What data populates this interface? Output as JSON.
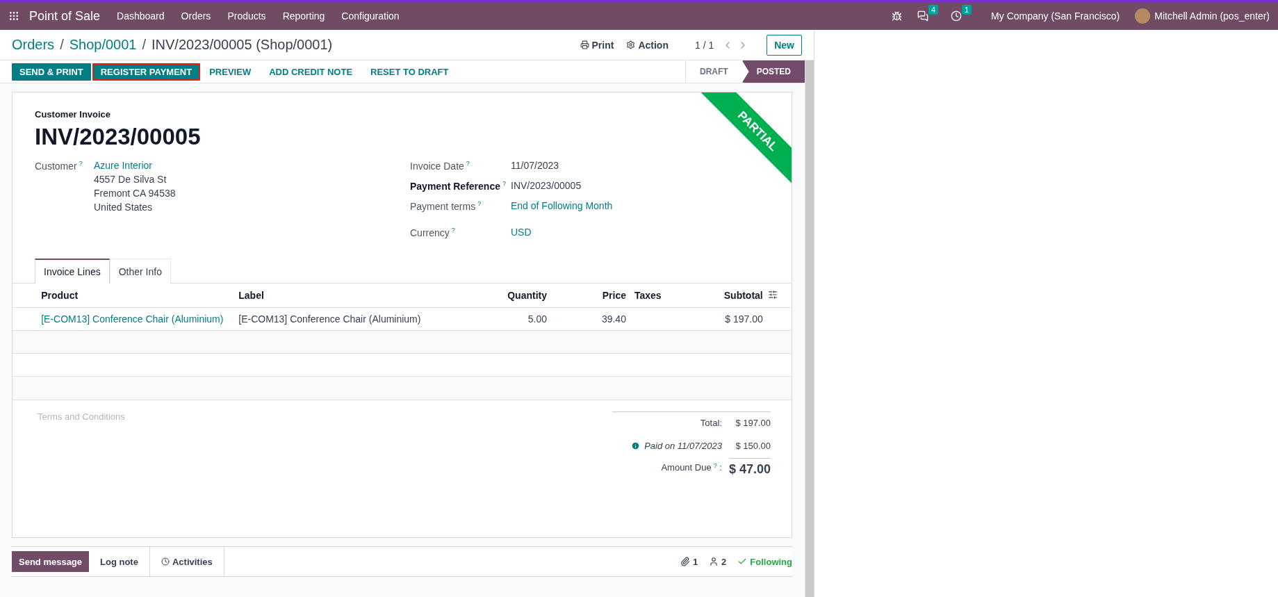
{
  "navbar": {
    "app_name": "Point of Sale",
    "menu": [
      "Dashboard",
      "Orders",
      "Products",
      "Reporting",
      "Configuration"
    ],
    "messages_count": "4",
    "activities_count": "1",
    "company": "My Company (San Francisco)",
    "user": "Mitchell Admin (pos_enter)"
  },
  "breadcrumbs": {
    "separator": "/",
    "items": [
      "Orders",
      "Shop/0001",
      "INV/2023/00005 (Shop/0001)"
    ]
  },
  "control": {
    "print": "Print",
    "action": "Action",
    "pager": "1 / 1",
    "new": "New"
  },
  "action_buttons": [
    {
      "label": "SEND & PRINT",
      "kind": "primary",
      "highlighted": false
    },
    {
      "label": "REGISTER PAYMENT",
      "kind": "primary",
      "highlighted": true
    },
    {
      "label": "PREVIEW",
      "kind": "link",
      "highlighted": false
    },
    {
      "label": "ADD CREDIT NOTE",
      "kind": "link",
      "highlighted": false
    },
    {
      "label": "RESET TO DRAFT",
      "kind": "link",
      "highlighted": false
    }
  ],
  "status_steps": [
    {
      "label": "DRAFT",
      "selected": false
    },
    {
      "label": "POSTED",
      "selected": true
    }
  ],
  "ribbon": "PARTIAL",
  "form": {
    "type_label": "Customer Invoice",
    "number": "INV/2023/00005",
    "customer": {
      "label": "Customer",
      "help": "?",
      "name": "Azure Interior",
      "address": [
        "4557 De Silva St",
        "Fremont CA 94538",
        "United States"
      ]
    },
    "fields": [
      {
        "label": "Invoice Date",
        "help": "?",
        "value": "11/07/2023",
        "kind": "text",
        "required": false
      },
      {
        "label": "Payment Reference",
        "help": "?",
        "value": "INV/2023/00005",
        "kind": "text",
        "required": true
      },
      {
        "label": "Payment terms",
        "help": "?",
        "value": "End of Following Month",
        "kind": "link",
        "required": false
      },
      {
        "label": "Currency",
        "help": "?",
        "value": "USD",
        "kind": "link",
        "required": false
      }
    ]
  },
  "tabs": [
    {
      "label": "Invoice Lines",
      "selected": true
    },
    {
      "label": "Other Info",
      "selected": false
    }
  ],
  "table": {
    "columns": [
      {
        "label": "Product"
      },
      {
        "label": "Label"
      },
      {
        "label": "Quantity"
      },
      {
        "label": "Price"
      },
      {
        "label": "Taxes"
      },
      {
        "label": "Subtotal"
      }
    ],
    "rows": [
      {
        "cells": [
          "[E-COM13] Conference Chair (Aluminium)",
          "[E-COM13] Conference Chair (Aluminium)",
          "5.00",
          "39.40",
          "",
          "$ 197.00"
        ]
      }
    ]
  },
  "terms": {
    "placeholder": "Terms and Conditions"
  },
  "totals": {
    "total_label": "Total:",
    "total": "$ 197.00",
    "payment_label": "Paid on 11/07/2023",
    "payment": "$ 150.00",
    "due_label": "Amount Due",
    "due_help": "?",
    "due_colon": ":",
    "due": "$ 47.00"
  },
  "chatter": {
    "send_message": "Send message",
    "log_note": "Log note",
    "activities": "Activities",
    "attachments": "1",
    "followers": "2",
    "following": "Following"
  }
}
